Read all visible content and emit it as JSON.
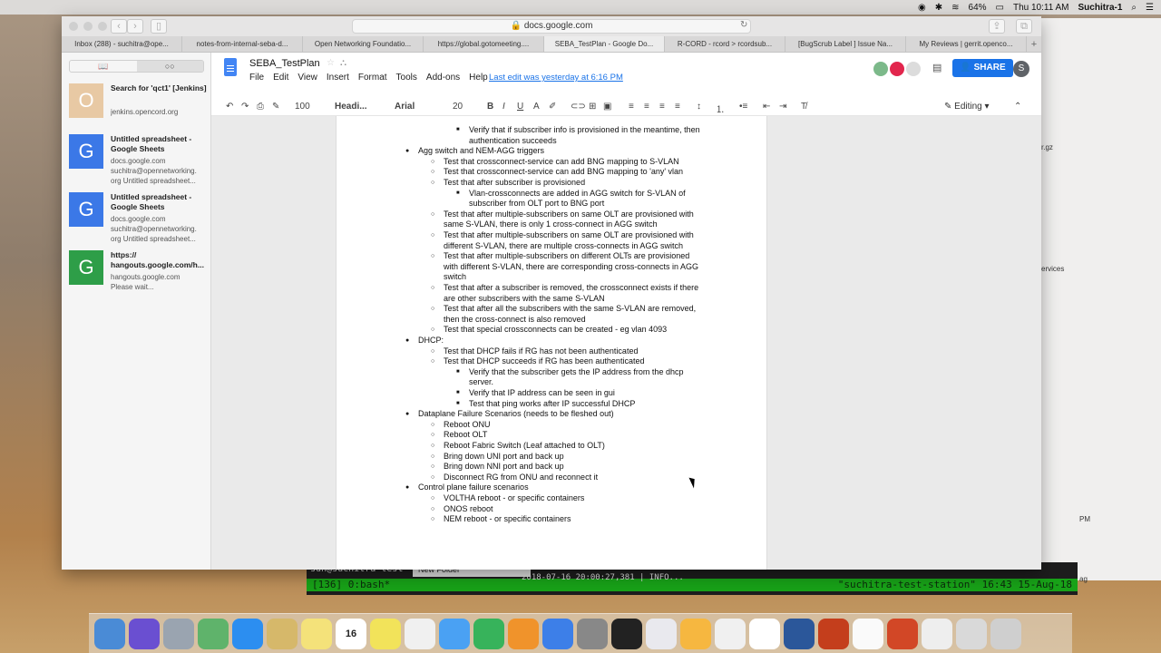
{
  "menubar": {
    "battery": "64%",
    "clock": "Thu 10:11 AM",
    "user": "Suchitra-1"
  },
  "browser": {
    "url": "docs.google.com",
    "tabs": [
      {
        "label": "Inbox (288) - suchitra@ope..."
      },
      {
        "label": "notes-from-internal-seba-d..."
      },
      {
        "label": "Open Networking Foundatio..."
      },
      {
        "label": "https://global.gotomeeting...."
      },
      {
        "label": "SEBA_TestPlan - Google Do..."
      },
      {
        "label": "R-CORD - rcord > rcordsub..."
      },
      {
        "label": "[BugScrub Label ] Issue Na..."
      },
      {
        "label": "My Reviews | gerrit.openco..."
      }
    ]
  },
  "sidebar": {
    "items": [
      {
        "thumb": "O",
        "color": "#e8c9a4",
        "title": "Search for 'qct1' [Jenkins]",
        "sub1": "jenkins.opencord.org",
        "sub2": "",
        "sub3": ""
      },
      {
        "thumb": "G",
        "color": "#3b78e7",
        "title": "Untitled spreadsheet - Google Sheets",
        "sub1": "docs.google.com",
        "sub2": "suchitra@opennetworking.",
        "sub3": "org Untitled spreadsheet..."
      },
      {
        "thumb": "G",
        "color": "#3b78e7",
        "title": "Untitled spreadsheet - Google Sheets",
        "sub1": "docs.google.com",
        "sub2": "suchitra@opennetworking.",
        "sub3": "org Untitled spreadsheet..."
      },
      {
        "thumb": "G",
        "color": "#2e9e48",
        "title": "https:// hangouts.google.com/h...",
        "sub1": "hangouts.google.com",
        "sub2": "Please wait...",
        "sub3": ""
      }
    ]
  },
  "docs": {
    "title": "SEBA_TestPlan",
    "menu": [
      "File",
      "Edit",
      "View",
      "Insert",
      "Format",
      "Tools",
      "Add-ons",
      "Help"
    ],
    "last_edit": "Last edit was yesterday at 6:16 PM",
    "share_label": "SHARE",
    "account_initial": "S",
    "toolbar": {
      "zoom": "100",
      "style": "Headi...",
      "font": "Arial",
      "size": "20",
      "editing": "Editing"
    }
  },
  "document": {
    "lines": [
      {
        "level": 3,
        "text": "Verify that if subscriber info is provisioned in the meantime, then"
      },
      {
        "level": 3,
        "cont": true,
        "text": "authentication succeeds"
      },
      {
        "level": 1,
        "text": "Agg switch and NEM-AGG triggers"
      },
      {
        "level": 2,
        "text": "Test that crossconnect-service can add BNG mapping to S-VLAN"
      },
      {
        "level": 2,
        "text": "Test that crossconnect-service can add BNG mapping to 'any' vlan"
      },
      {
        "level": 2,
        "text": "Test that after subscriber is provisioned"
      },
      {
        "level": 3,
        "text": "Vlan-crossconnects are added in AGG switch for S-VLAN of"
      },
      {
        "level": 3,
        "cont": true,
        "text": "subscriber from OLT port to BNG port"
      },
      {
        "level": 2,
        "text": "Test that after multiple-subscribers on same OLT are provisioned with"
      },
      {
        "level": 2,
        "cont": true,
        "text": "same S-VLAN, there is only 1 cross-connect in AGG switch"
      },
      {
        "level": 2,
        "text": "Test that after multiple-subscribers on same OLT are provisioned with"
      },
      {
        "level": 2,
        "cont": true,
        "text": "different S-VLAN, there are multiple cross-connects in AGG switch"
      },
      {
        "level": 2,
        "text": "Test that after multiple-subscribers on different OLTs are provisioned"
      },
      {
        "level": 2,
        "cont": true,
        "text": "with different S-VLAN, there are corresponding cross-connects in AGG"
      },
      {
        "level": 2,
        "cont": true,
        "text": "switch"
      },
      {
        "level": 2,
        "text": "Test that after a subscriber is removed, the crossconnect exists if there"
      },
      {
        "level": 2,
        "cont": true,
        "text": "are other subscribers with the same S-VLAN"
      },
      {
        "level": 2,
        "text": "Test that after all the subscribers with the same S-VLAN are removed,"
      },
      {
        "level": 2,
        "cont": true,
        "text": "then the cross-connect is also removed"
      },
      {
        "level": 2,
        "text": "Test that special crossconnects can be created - eg vlan 4093"
      },
      {
        "level": 1,
        "text": "DHCP:"
      },
      {
        "level": 2,
        "text": "Test that DHCP fails if RG has not been authenticated"
      },
      {
        "level": 2,
        "text": "Test that DHCP succeeds if RG has been authenticated"
      },
      {
        "level": 3,
        "text": "Verify that the subscriber gets the IP address from the dhcp"
      },
      {
        "level": 3,
        "cont": true,
        "text": "server."
      },
      {
        "level": 3,
        "text": "Verify that IP address can be seen in gui"
      },
      {
        "level": 3,
        "text": "Test that ping works after IP successful DHCP"
      },
      {
        "level": 1,
        "text": "Dataplane Failure Scenarios (needs to be fleshed out)"
      },
      {
        "level": 2,
        "text": "Reboot ONU"
      },
      {
        "level": 2,
        "text": "Reboot OLT"
      },
      {
        "level": 2,
        "text": "Reboot Fabric Switch (Leaf attached to OLT)"
      },
      {
        "level": 2,
        "text": "Bring down UNI port and back up"
      },
      {
        "level": 2,
        "text": "Bring down NNI port and back up"
      },
      {
        "level": 2,
        "text": "Disconnect RG from ONU and reconnect it"
      },
      {
        "level": 1,
        "text": "Control plane failure scenarios"
      },
      {
        "level": 2,
        "text": "VOLTHA reboot - or specific containers"
      },
      {
        "level": 2,
        "text": "ONOS reboot"
      },
      {
        "level": 2,
        "text": "NEM reboot - or specific containers"
      }
    ]
  },
  "background": {
    "terminal_line": "sdn@suchitra-test",
    "terminal_status_left": "[136] 0:bash*",
    "terminal_status_right": "\"suchitra-test-station\" 16:43 15-Aug-18",
    "finder_label": "New Folder",
    "log_text": "2018-07-16 20:00:27,381 | INFO...",
    "right_text_services": "ervices",
    "right_text_gz": "r.gz",
    "right_text_pm": "PM",
    "right_text_ag": "ag"
  },
  "dock": {
    "icons": [
      "finder-icon",
      "siri-icon",
      "launchpad-icon",
      "maps-icon",
      "safari-icon",
      "preview-icon",
      "notes-icon",
      "calendar-icon",
      "stickies-icon",
      "photos-icon",
      "messages-icon",
      "facetime-icon",
      "ibooks-icon",
      "appstore-icon",
      "sysprefs-icon",
      "terminal-icon",
      "itunes-icon",
      "sketch-icon",
      "slack-icon",
      "chrome-icon",
      "word-icon",
      "powerpoint-icon",
      "textedit-icon",
      "app-icon",
      "folder-icon",
      "downloads-icon",
      "trash-icon"
    ],
    "calendar_day": "16"
  }
}
